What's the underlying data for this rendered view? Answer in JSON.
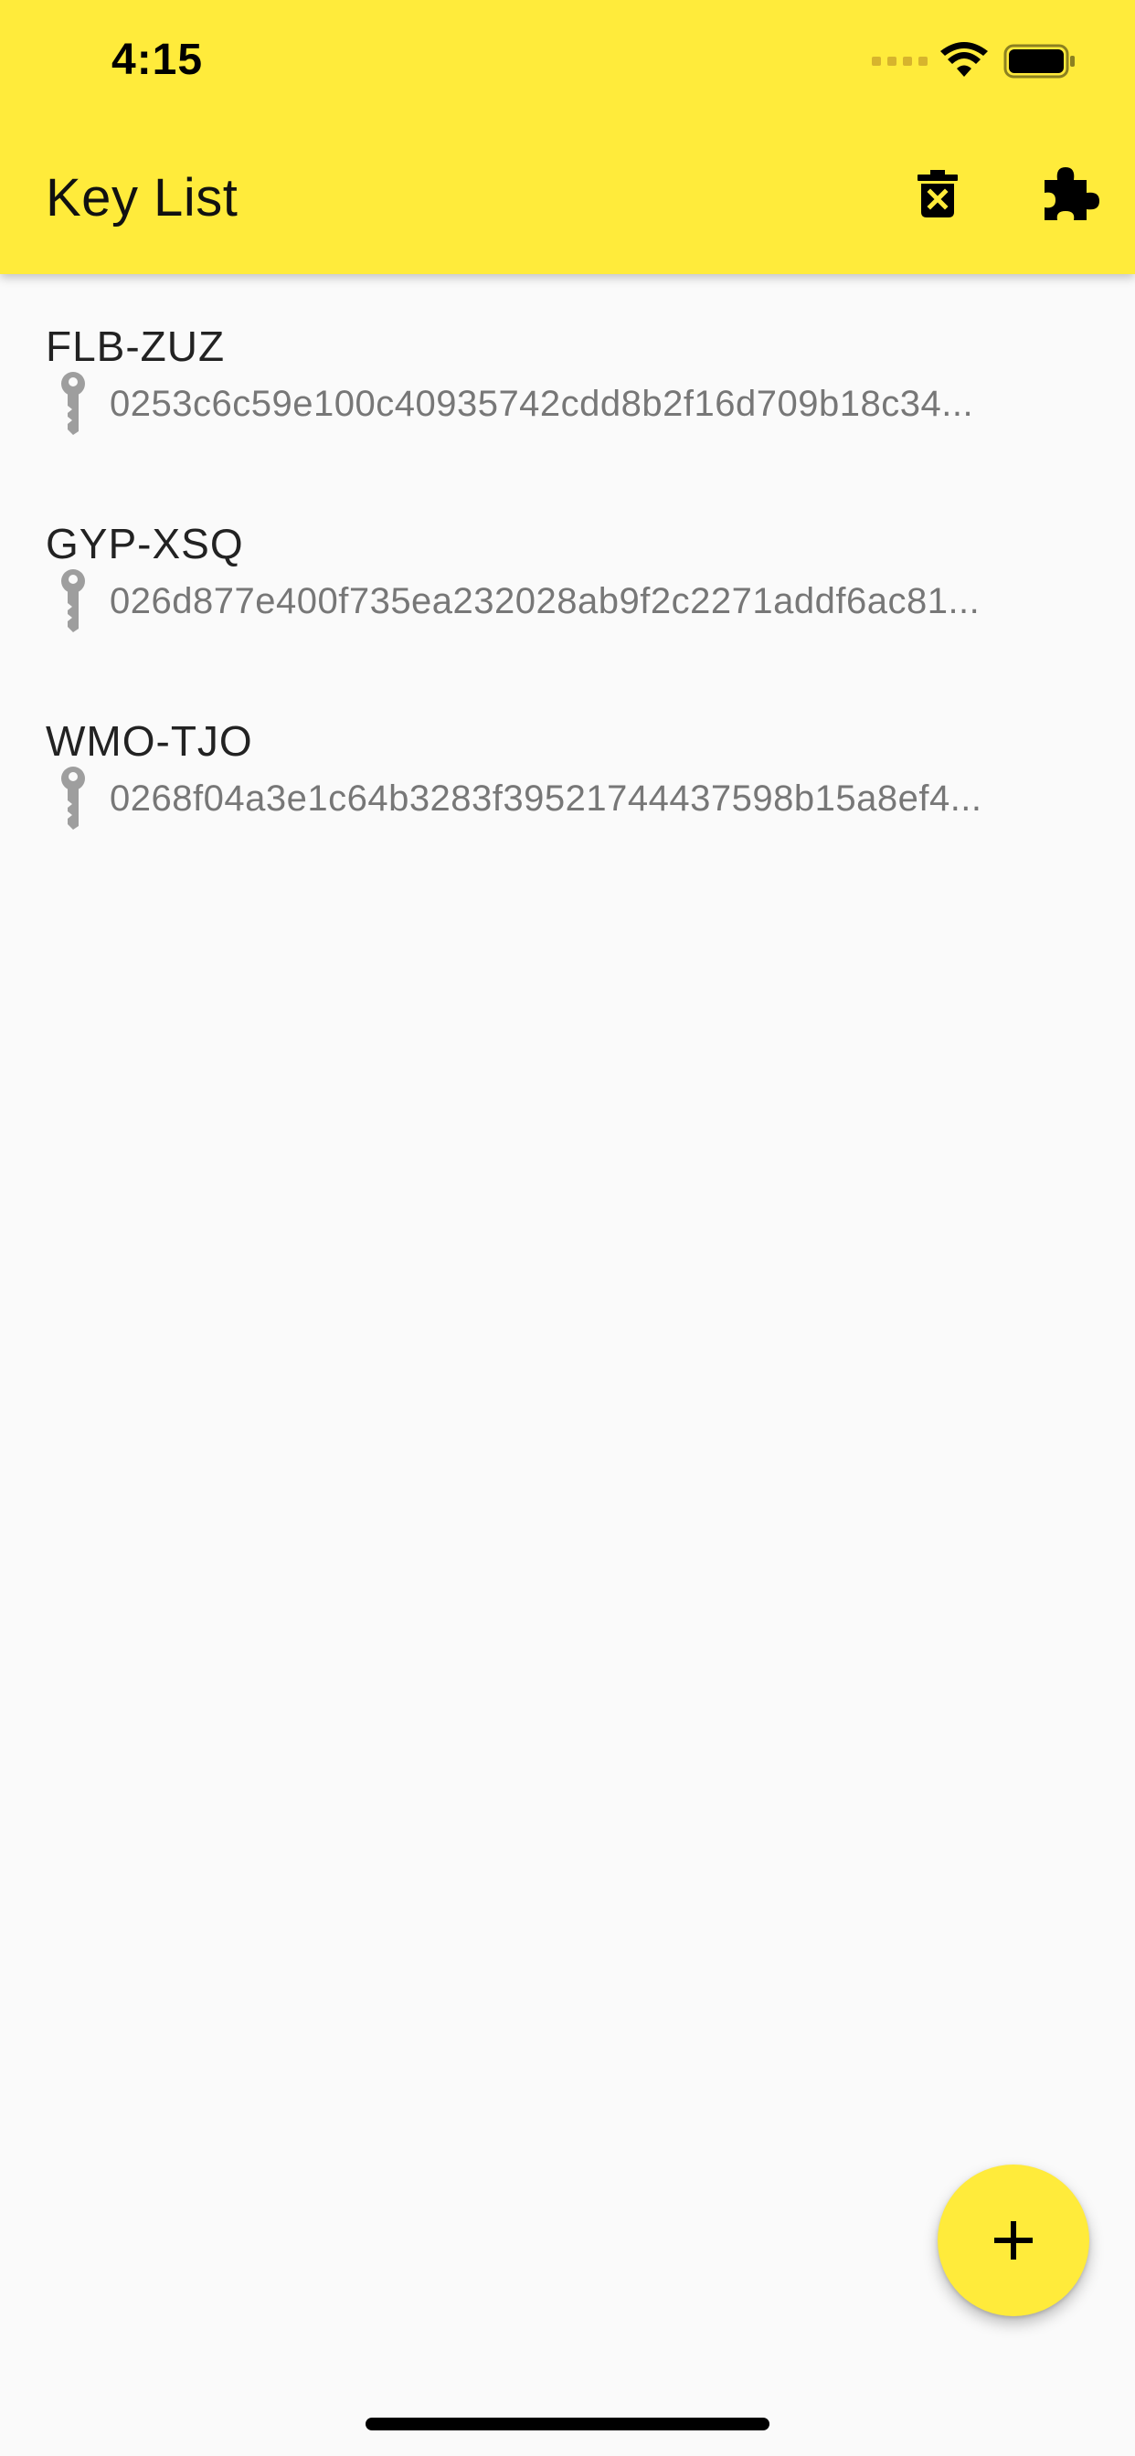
{
  "status_bar": {
    "time": "4:15",
    "icons": [
      "cellular-signal-icon",
      "wifi-icon",
      "battery-icon"
    ]
  },
  "app_bar": {
    "title": "Key List",
    "actions": [
      {
        "name": "delete-all",
        "icon": "delete-forever-icon"
      },
      {
        "name": "plugins",
        "icon": "puzzle-extension-icon"
      }
    ],
    "background_color": "#ffeb3b"
  },
  "keys": [
    {
      "name": "FLB-ZUZ",
      "public_key": "0253c6c59e100c40935742cdd8b2f16d709b18c34..."
    },
    {
      "name": "GYP-XSQ",
      "public_key": "026d877e400f735ea232028ab9f2c2271addf6ac81..."
    },
    {
      "name": "WMO-TJO",
      "public_key": "0268f04a3e1c64b3283f39521744437598b15a8ef4..."
    }
  ],
  "fab": {
    "icon": "add-icon",
    "color": "#ffeb3b"
  },
  "colors": {
    "background": "#fafafa",
    "secondary_text": "#777777",
    "key_icon": "#9e9e9e"
  }
}
